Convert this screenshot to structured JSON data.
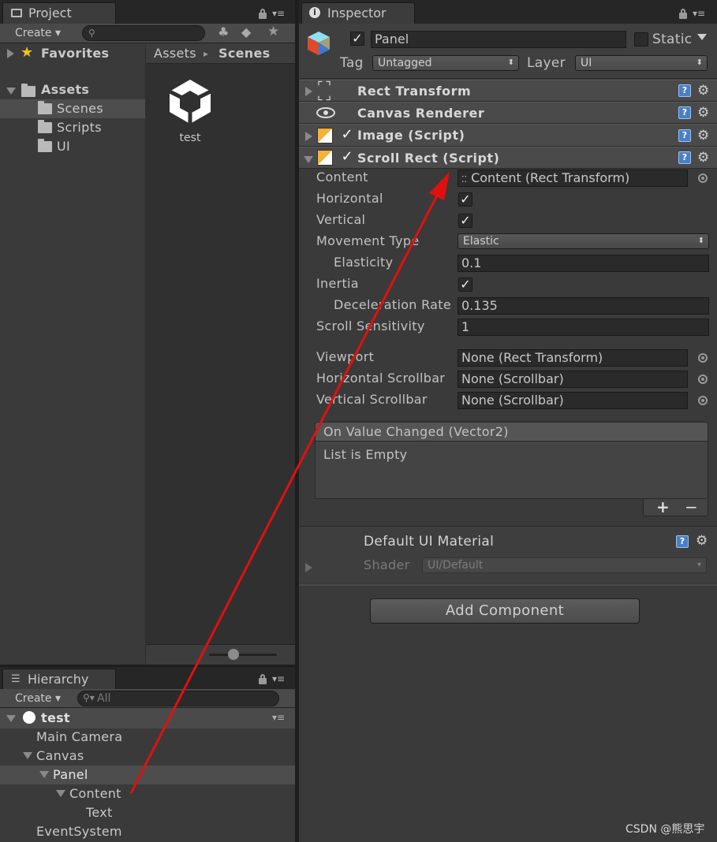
{
  "project": {
    "tab_label": "Project",
    "create_label": "Create",
    "favorites_label": "Favorites",
    "assets_label": "Assets",
    "folders": [
      "Scenes",
      "Scripts",
      "UI"
    ],
    "breadcrumb_root": "Assets",
    "breadcrumb_sep": "▸",
    "breadcrumb_current": "Scenes",
    "asset_name": "test"
  },
  "hierarchy": {
    "tab_label": "Hierarchy",
    "create_label": "Create",
    "search_placeholder": "All",
    "scene_name": "test",
    "items": [
      "Main Camera",
      "Canvas",
      "Panel",
      "Content",
      "Text",
      "EventSystem"
    ]
  },
  "inspector": {
    "tab_label": "Inspector",
    "object_name": "Panel",
    "static_label": "Static",
    "tag_label": "Tag",
    "tag_value": "Untagged",
    "layer_label": "Layer",
    "layer_value": "UI",
    "components": {
      "rect_transform": "Rect Transform",
      "canvas_renderer": "Canvas Renderer",
      "image": "Image (Script)",
      "scroll_rect": "Scroll Rect (Script)"
    },
    "scroll_rect": {
      "content_label": "Content",
      "content_value": "Content (Rect Transform)",
      "horizontal_label": "Horizontal",
      "vertical_label": "Vertical",
      "movement_type_label": "Movement Type",
      "movement_type_value": "Elastic",
      "elasticity_label": "Elasticity",
      "elasticity_value": "0.1",
      "inertia_label": "Inertia",
      "deceleration_label": "Deceleration Rate",
      "deceleration_value": "0.135",
      "sensitivity_label": "Scroll Sensitivity",
      "sensitivity_value": "1",
      "viewport_label": "Viewport",
      "viewport_value": "None (Rect Transform)",
      "hscroll_label": "Horizontal Scrollbar",
      "hscroll_value": "None (Scrollbar)",
      "vscroll_label": "Vertical Scrollbar",
      "vscroll_value": "None (Scrollbar)",
      "event_title": "On Value Changed (Vector2)",
      "event_empty": "List is Empty",
      "add_symbol": "+",
      "remove_symbol": "−"
    },
    "material": {
      "name": "Default UI Material",
      "shader_label": "Shader",
      "shader_value": "UI/Default"
    },
    "add_component_label": "Add Component"
  },
  "watermark": "CSDN @熊思宇",
  "colors": {
    "annotation_arrow": "#e01010",
    "help_icon": "#4a7fc6"
  }
}
